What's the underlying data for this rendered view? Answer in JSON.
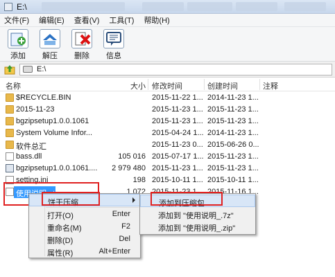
{
  "window": {
    "title": "E:\\"
  },
  "menu": [
    "文件(F)",
    "编辑(E)",
    "查看(V)",
    "工具(T)",
    "帮助(H)"
  ],
  "toolbar": [
    {
      "label": "添加",
      "icon": "add-icon"
    },
    {
      "label": "解压",
      "icon": "extract-icon"
    },
    {
      "label": "删除",
      "icon": "delete-icon"
    },
    {
      "label": "信息",
      "icon": "info-icon"
    }
  ],
  "address": {
    "value": "E:\\"
  },
  "columns": {
    "name": "名称",
    "size": "大小",
    "modified": "修改时间",
    "created": "创建时间",
    "comment": "注释"
  },
  "files": [
    {
      "name": "$RECYCLE.BIN",
      "size": "",
      "modified": "2015-11-22 1...",
      "created": "2014-11-23 1...",
      "type": "folder"
    },
    {
      "name": "2015-11-23",
      "size": "",
      "modified": "2015-11-23 1...",
      "created": "2015-11-23 1...",
      "type": "folder"
    },
    {
      "name": "bgzipsetup1.0.0.1061",
      "size": "",
      "modified": "2015-11-23 1...",
      "created": "2015-11-23 1...",
      "type": "folder"
    },
    {
      "name": "System Volume Infor...",
      "size": "",
      "modified": "2015-04-24 1...",
      "created": "2014-11-23 1...",
      "type": "folder"
    },
    {
      "name": "软件总汇",
      "size": "",
      "modified": "2015-11-23 0...",
      "created": "2015-06-26 0...",
      "type": "folder"
    },
    {
      "name": "bass.dll",
      "size": "105 016",
      "modified": "2015-07-17 1...",
      "created": "2015-11-23 1...",
      "type": "file"
    },
    {
      "name": "bgzipsetup1.0.0.1061....",
      "size": "2 979 480",
      "modified": "2015-11-23 1...",
      "created": "2015-11-23 1...",
      "type": "exe"
    },
    {
      "name": "setting.ini",
      "size": "198",
      "modified": "2015-10-11 1...",
      "created": "2015-10-11 1...",
      "type": "file"
    },
    {
      "name": "使用说明_.txt",
      "size": "1 072",
      "modified": "2015-11-23 1...",
      "created": "2015-11-16 1...",
      "type": "file",
      "selected": true
    }
  ],
  "context_menu": [
    {
      "label": "饼干压缩",
      "key": "",
      "submenu": true,
      "highlighted": true
    },
    {
      "label": "打开(O)",
      "key": "Enter"
    },
    {
      "label": "重命名(M)",
      "key": "F2"
    },
    {
      "label": "删除(D)",
      "key": "Del"
    },
    {
      "label": "属性(R)",
      "key": "Alt+Enter"
    }
  ],
  "submenu": [
    {
      "label": "添加到压缩包...",
      "highlighted": true
    },
    {
      "label": "添加到 \"使用说明_.7z\""
    },
    {
      "label": "添加到 \"使用说明_.zip\""
    }
  ],
  "colors": {
    "highlight": "#e02020",
    "selection": "#3399ff",
    "folder": "#e8b84b"
  }
}
